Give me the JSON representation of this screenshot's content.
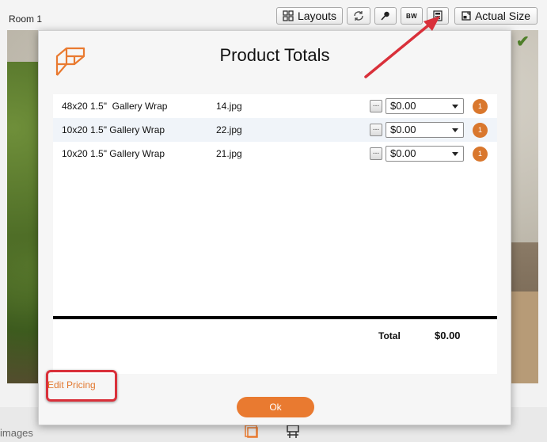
{
  "window": {
    "room_label": "Room 1"
  },
  "toolbar": {
    "layouts_label": "Layouts",
    "bw_label": "BW",
    "actual_size_label": "Actual Size",
    "icons": [
      "layouts-grid-icon",
      "rotate-icon",
      "pin-icon",
      "bw-icon",
      "calculator-icon",
      "actual-size-icon"
    ]
  },
  "modal": {
    "title": "Product Totals",
    "rows": [
      {
        "product": "48x20 1.5\"  Gallery Wrap",
        "file": "14.jpg",
        "dots": "...",
        "price": "$0.00",
        "qty": "1"
      },
      {
        "product": "10x20 1.5\" Gallery Wrap",
        "file": "22.jpg",
        "dots": "...",
        "price": "$0.00",
        "qty": "1"
      },
      {
        "product": "10x20 1.5\" Gallery Wrap",
        "file": "21.jpg",
        "dots": "...",
        "price": "$0.00",
        "qty": "1"
      }
    ],
    "total_label": "Total",
    "total_value": "$0.00",
    "edit_pricing_label": "Edit Pricing",
    "ok_label": "Ok"
  },
  "bottom": {
    "images_label": "images"
  },
  "colors": {
    "accent_orange": "#e97a30",
    "badge_orange": "#d9772d",
    "annotation_red": "#d9303a",
    "check_green": "#4f7f2a"
  }
}
